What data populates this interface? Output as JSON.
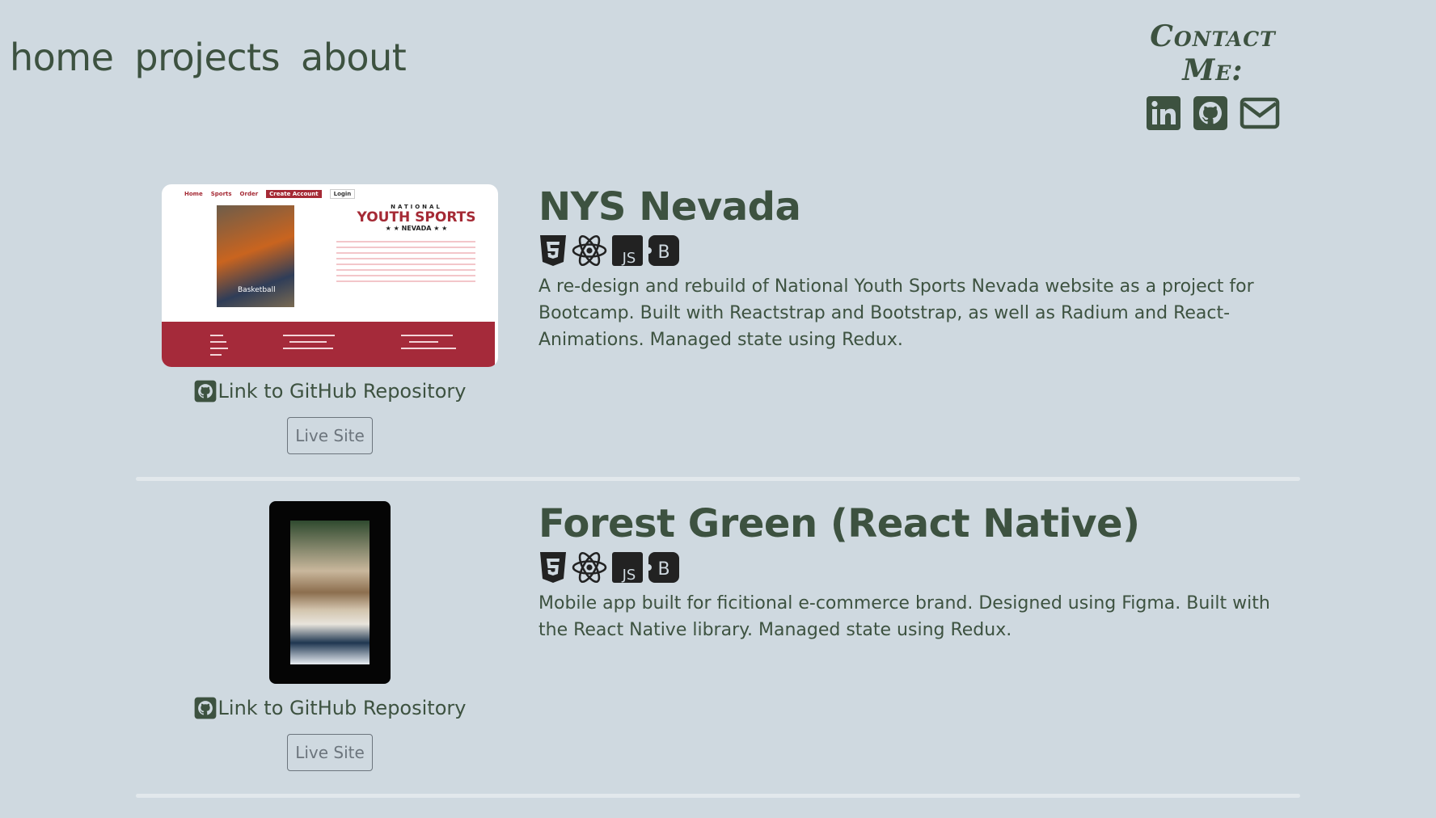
{
  "nav": {
    "items": [
      {
        "label": "home"
      },
      {
        "label": "projects"
      },
      {
        "label": "about"
      }
    ]
  },
  "contact": {
    "title": "Contact Me:",
    "icons": [
      "linkedin-icon",
      "github-icon",
      "envelope-icon"
    ]
  },
  "projects": [
    {
      "title": "NYS Nevada",
      "tech": [
        "html5-icon",
        "react-icon",
        "javascript-icon",
        "bootstrap-icon"
      ],
      "description": "A re-design and rebuild of National Youth Sports Nevada website as a project for Bootcamp. Built with Reactstrap and Bootstrap, as well as Radium and React-Animations. Managed state using Redux.",
      "repo_link": "Link to GitHub Repository",
      "live_label": "Live Site",
      "thumb": {
        "nav": [
          "Home",
          "Sports",
          "Order",
          "Create Account",
          "Login"
        ],
        "heading_top": "NATIONAL",
        "heading_main": "YOUTH SPORTS",
        "heading_sub": "★ ★ NEVADA ★ ★",
        "photo_label": "Basketball"
      }
    },
    {
      "title": "Forest Green (React Native)",
      "tech": [
        "html5-icon",
        "react-icon",
        "javascript-icon",
        "bootstrap-icon"
      ],
      "description": "Mobile app built for ficitional e-commerce brand. Designed using Figma. Built with the React Native library. Managed state using Redux.",
      "repo_link": "Link to GitHub Repository",
      "live_label": "Live Site"
    }
  ],
  "colors": {
    "background": "#cfd9e0",
    "primary_text": "#3d5240",
    "button_border": "#6c757d"
  }
}
